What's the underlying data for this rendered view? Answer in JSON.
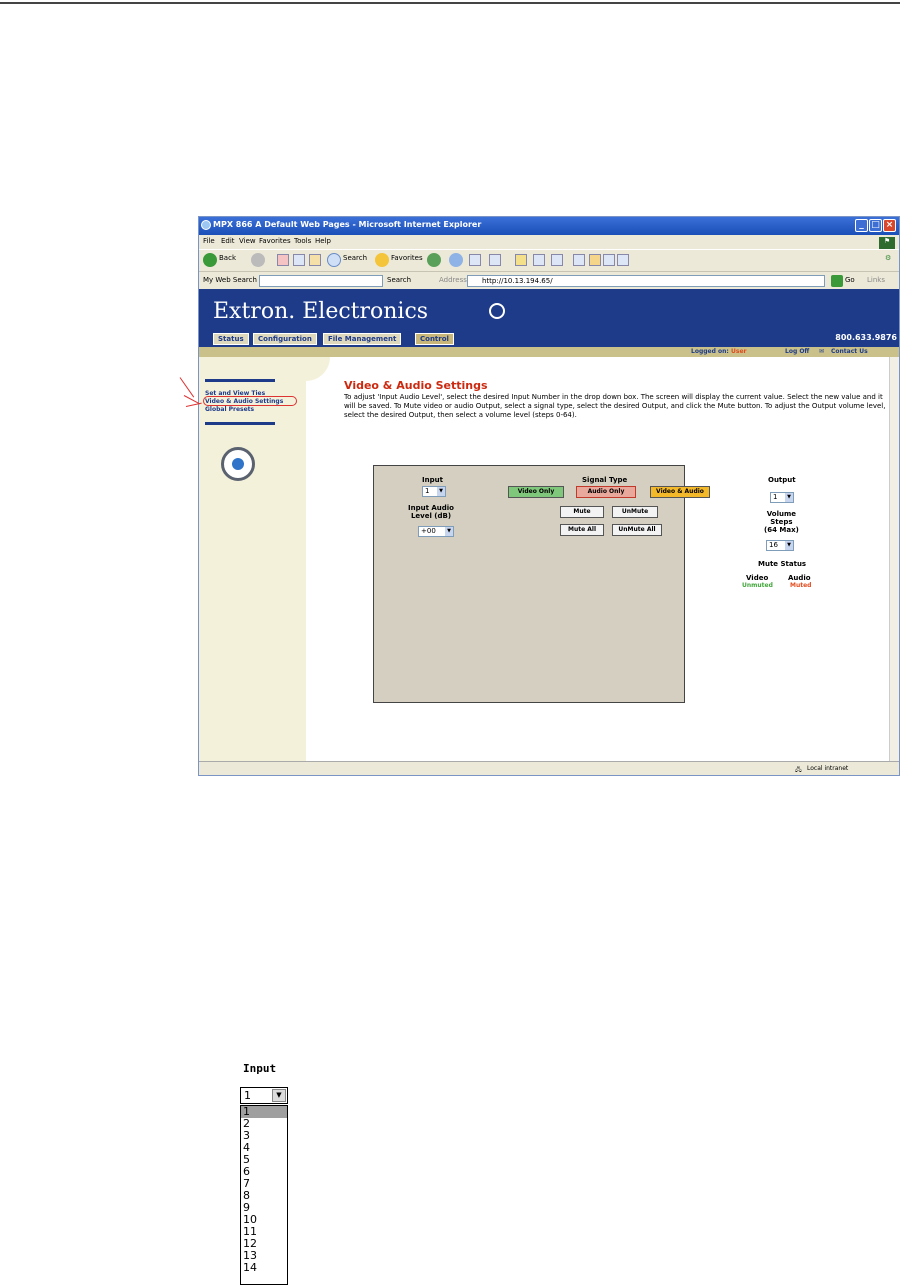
{
  "browser": {
    "title": "MPX 866 A Default Web Pages - Microsoft Internet Explorer",
    "menu": [
      "File",
      "Edit",
      "View",
      "Favorites",
      "Tools",
      "Help"
    ],
    "toolbar": {
      "back": "Back",
      "search": "Search",
      "favorites": "Favorites"
    },
    "my_web_search_label": "My Web Search",
    "search_button": "Search",
    "address_label": "Address",
    "address_value": "http://10.13.194.65/",
    "go_label": "Go",
    "links_label": "Links",
    "status_zone": "Local intranet"
  },
  "page": {
    "brand": "Extron. Electronics",
    "phone": "800.633.9876",
    "nav_tabs": [
      "Status",
      "Configuration",
      "File Management",
      "Control"
    ],
    "active_tab": "Control",
    "logged_on_label": "Logged on:",
    "logged_on_user": "User",
    "log_off": "Log Off",
    "contact_us": "Contact Us",
    "sidebar_items": [
      "Set and View Ties",
      "Video & Audio Settings",
      "Global Presets"
    ],
    "title": "Video & Audio Settings",
    "description": "To adjust 'Input Audio Level', select the desired Input Number in the drop down box. The screen will display the current value. Select the new value and it will be saved. To Mute video or audio Output, select a signal type, select the desired Output, and click the Mute button. To adjust the Output volume level, select the desired Output, then select a volume level (steps 0-64)."
  },
  "panel": {
    "input_label": "Input",
    "input_value": "1",
    "input_audio_label": "Input Audio\nLevel (dB)",
    "input_audio_value": "+00",
    "signal_type_label": "Signal Type",
    "video_only": "Video Only",
    "audio_only": "Audio Only",
    "video_audio": "Video & Audio",
    "mute": "Mute",
    "unmute": "UnMute",
    "mute_all": "Mute All",
    "unmute_all": "UnMute All",
    "output_label": "Output",
    "output_value": "1",
    "volume_label": "Volume\nSteps\n(64 Max)",
    "volume_value": "16",
    "mute_status_label": "Mute Status",
    "video_col": "Video",
    "audio_col": "Audio",
    "video_status": "Unmuted",
    "audio_status": "Muted",
    "colors": {
      "video_only": "#7fc77a",
      "audio_only": "#e8a89c",
      "video_audio": "#f4b82b",
      "unmuted": "#41a63a",
      "muted": "#e24a1c"
    }
  },
  "dropdown": {
    "label": "Input",
    "selected": "1",
    "options": [
      "1",
      "2",
      "3",
      "4",
      "5",
      "6",
      "7",
      "8",
      "9",
      "10",
      "11",
      "12",
      "13",
      "14"
    ]
  }
}
